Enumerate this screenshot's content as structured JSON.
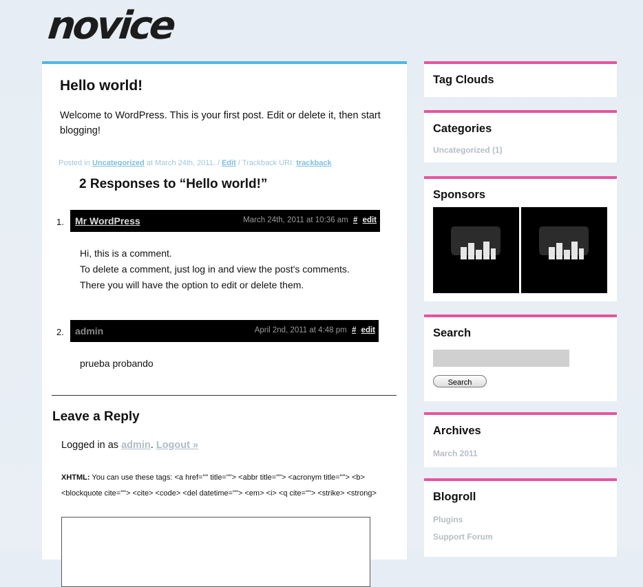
{
  "site": {
    "logo_text": "novice"
  },
  "post": {
    "title": "Hello world!",
    "body": "Welcome to WordPress. This is your first post. Edit or delete it, then start blogging!",
    "meta_posted_in": "Posted in",
    "meta_category": "Uncategorized",
    "meta_date": "at March 24th, 2011. /",
    "meta_edit": "Edit",
    "meta_trackback_label": "/ Trackback URI:",
    "meta_trackback": "trackback"
  },
  "responses": {
    "title": "2 Responses to “Hello world!”",
    "comments": [
      {
        "num": "1.",
        "author": "Mr WordPress",
        "date": "March 24th, 2011 at 10:36 am",
        "hash": "#",
        "edit": "edit",
        "lines": [
          "Hi, this is a comment.",
          "To delete a comment, just log in and view the post's comments.",
          "There you will have the option to edit or delete them."
        ]
      },
      {
        "num": "2.",
        "author": "admin",
        "date": "April 2nd, 2011 at 4:48 pm",
        "hash": "#",
        "edit": "edit",
        "lines": [
          "prueba probando"
        ]
      }
    ]
  },
  "reply": {
    "title": "Leave a Reply",
    "logged_prefix": "Logged in as",
    "logged_user": "admin",
    "logout": "Logout »",
    "xhtml_label": "XHTML:",
    "xhtml_text": "You can use these tags: <a href=\"\" title=\"\"> <abbr title=\"\"> <acronym title=\"\"> <b> <blockquote cite=\"\"> <cite> <code> <del datetime=\"\"> <em> <i> <q cite=\"\"> <strike> <strong>"
  },
  "sidebar": {
    "tag_clouds": {
      "title": "Tag Clouds"
    },
    "categories": {
      "title": "Categories",
      "items": [
        "Uncategorized (1)"
      ]
    },
    "sponsors": {
      "title": "Sponsors"
    },
    "search": {
      "title": "Search",
      "button": "Search"
    },
    "archives": {
      "title": "Archives",
      "items": [
        "March 2011"
      ]
    },
    "blogroll": {
      "title": "Blogroll",
      "items": [
        "Plugins",
        "Support Forum"
      ]
    }
  },
  "colors": {
    "main_accent": "#4cb7e6",
    "sidebar_accent": "#e6549d"
  }
}
